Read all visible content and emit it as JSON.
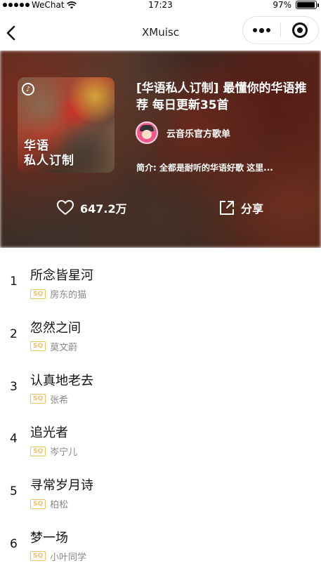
{
  "status_bar": {
    "carrier": "WeChat",
    "time": "17:23",
    "battery": "97%",
    "battery_level": 0.97
  },
  "nav": {
    "title": "XMuisc"
  },
  "playlist": {
    "cover_text_line1": "华语",
    "cover_text_line2": "私人订制",
    "title": "[华语私人订制] 最懂你的华语推荐 每日更新35首",
    "creator": "云音乐官方歌单",
    "description": "简介: 全都是耐听的华语好歌 这里...",
    "likes": "647.2万",
    "share_label": "分享"
  },
  "songs": [
    {
      "index": "1",
      "title": "所念皆星河",
      "quality": "SQ",
      "artist": "房东的猫"
    },
    {
      "index": "2",
      "title": "忽然之间",
      "quality": "SQ",
      "artist": "莫文蔚"
    },
    {
      "index": "3",
      "title": "认真地老去",
      "quality": "SQ",
      "artist": "张希"
    },
    {
      "index": "4",
      "title": "追光者",
      "quality": "SQ",
      "artist": "岑宁儿"
    },
    {
      "index": "5",
      "title": "寻常岁月诗",
      "quality": "SQ",
      "artist": "柏松"
    },
    {
      "index": "6",
      "title": "梦一场",
      "quality": "SQ",
      "artist": "小叶同学"
    }
  ],
  "icons": {
    "back": "chevron-left-icon",
    "more": "more-dots-icon",
    "close": "target-circle-icon",
    "like": "heart-icon",
    "share": "share-out-icon"
  }
}
